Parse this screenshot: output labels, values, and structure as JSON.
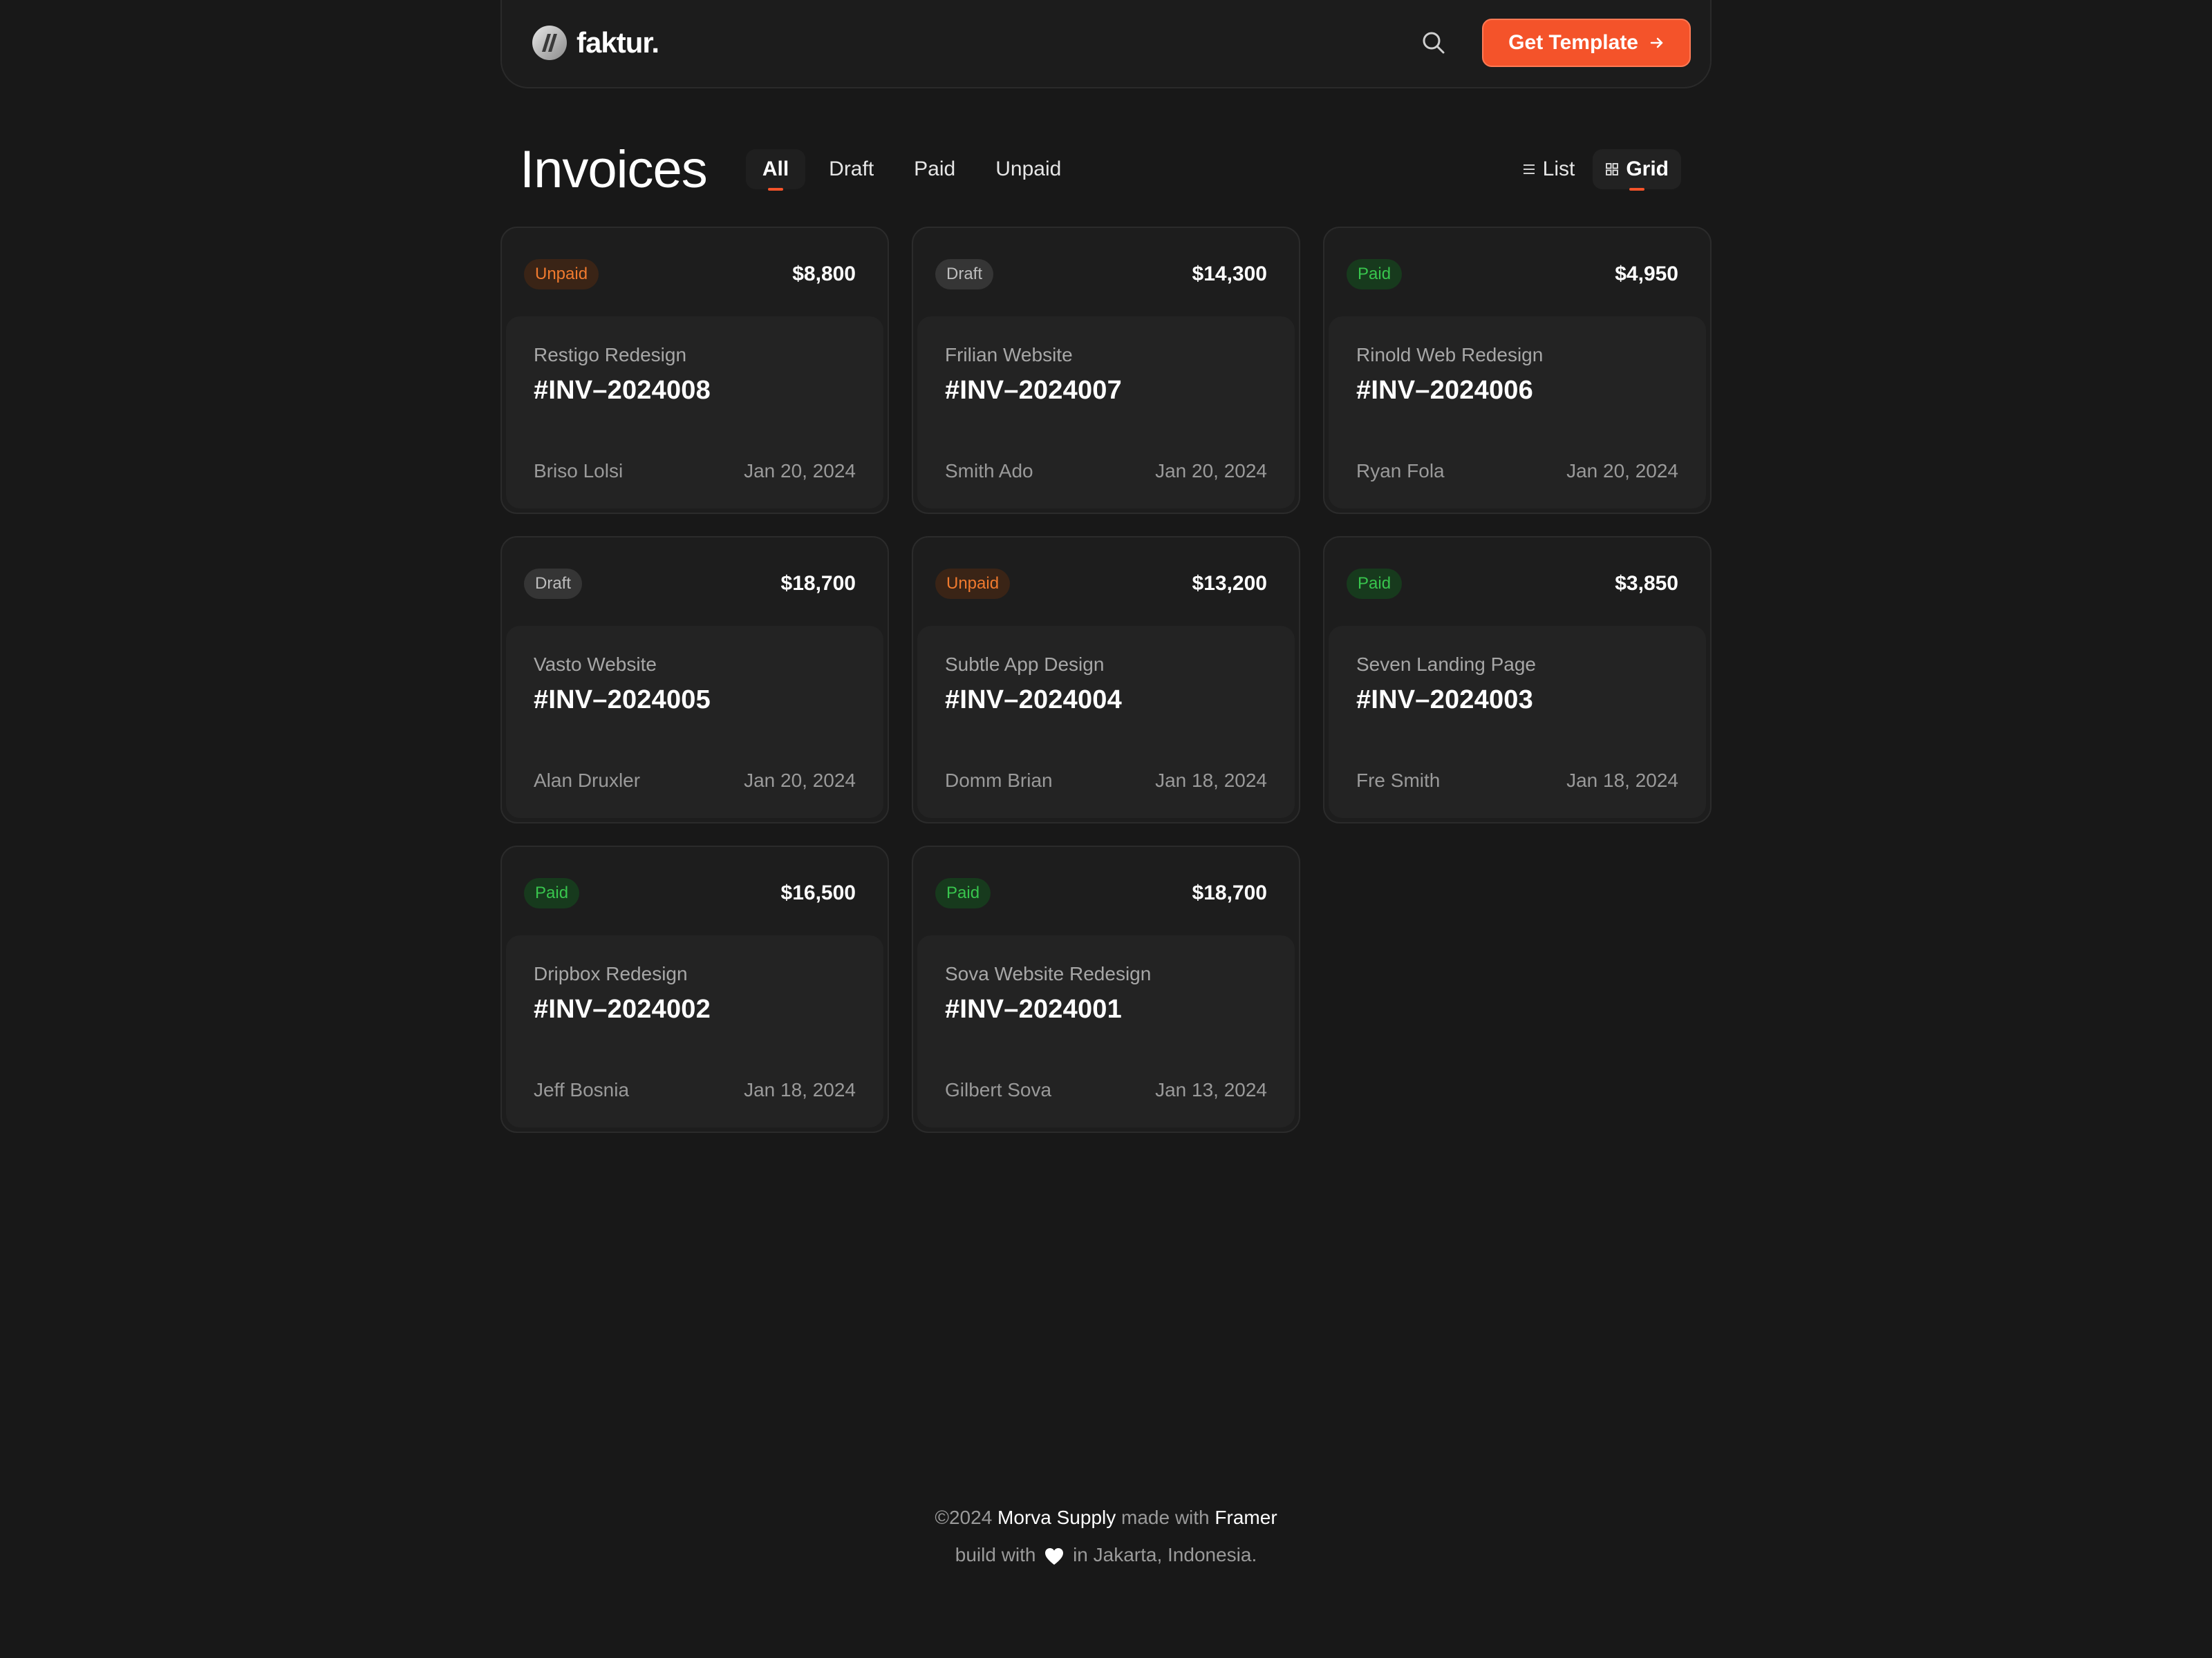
{
  "header": {
    "logo_text": "faktur.",
    "cta_label": "Get Template"
  },
  "page": {
    "title": "Invoices",
    "tabs": [
      {
        "label": "All",
        "active": true
      },
      {
        "label": "Draft",
        "active": false
      },
      {
        "label": "Paid",
        "active": false
      },
      {
        "label": "Unpaid",
        "active": false
      }
    ],
    "views": [
      {
        "label": "List",
        "active": false
      },
      {
        "label": "Grid",
        "active": true
      }
    ]
  },
  "invoices": [
    {
      "status": "Unpaid",
      "amount": "$8,800",
      "project": "Restigo Redesign",
      "number": "#INV–2024008",
      "client": "Briso Lolsi",
      "date": "Jan 20, 2024"
    },
    {
      "status": "Draft",
      "amount": "$14,300",
      "project": "Frilian Website",
      "number": "#INV–2024007",
      "client": "Smith Ado",
      "date": "Jan 20, 2024"
    },
    {
      "status": "Paid",
      "amount": "$4,950",
      "project": "Rinold Web Redesign",
      "number": "#INV–2024006",
      "client": "Ryan Fola",
      "date": "Jan 20, 2024"
    },
    {
      "status": "Draft",
      "amount": "$18,700",
      "project": "Vasto Website",
      "number": "#INV–2024005",
      "client": "Alan Druxler",
      "date": "Jan 20, 2024"
    },
    {
      "status": "Unpaid",
      "amount": "$13,200",
      "project": "Subtle App Design",
      "number": "#INV–2024004",
      "client": "Domm Brian",
      "date": "Jan 18, 2024"
    },
    {
      "status": "Paid",
      "amount": "$3,850",
      "project": "Seven Landing Page",
      "number": "#INV–2024003",
      "client": "Fre Smith",
      "date": "Jan 18, 2024"
    },
    {
      "status": "Paid",
      "amount": "$16,500",
      "project": "Dripbox Redesign",
      "number": "#INV–2024002",
      "client": "Jeff Bosnia",
      "date": "Jan 18, 2024"
    },
    {
      "status": "Paid",
      "amount": "$18,700",
      "project": "Sova Website Redesign",
      "number": "#INV–2024001",
      "client": "Gilbert Sova",
      "date": "Jan 13, 2024"
    }
  ],
  "footer": {
    "copyright": "©2024",
    "brand": "Morva Supply",
    "made_with": "made with",
    "tool": "Framer",
    "build_with": "build with",
    "location": "in Jakarta, Indonesia."
  },
  "colors": {
    "accent": "#f4532a",
    "background": "#181818",
    "unpaid": "#f07a2e",
    "paid": "#38c54d",
    "draft": "#bdbdbd"
  },
  "icons": {
    "logo": "faktur-logo-icon",
    "search": "search-icon",
    "cta": "arrow-right-icon",
    "list": "list-icon",
    "grid": "grid-icon",
    "heart": "heart-icon"
  }
}
